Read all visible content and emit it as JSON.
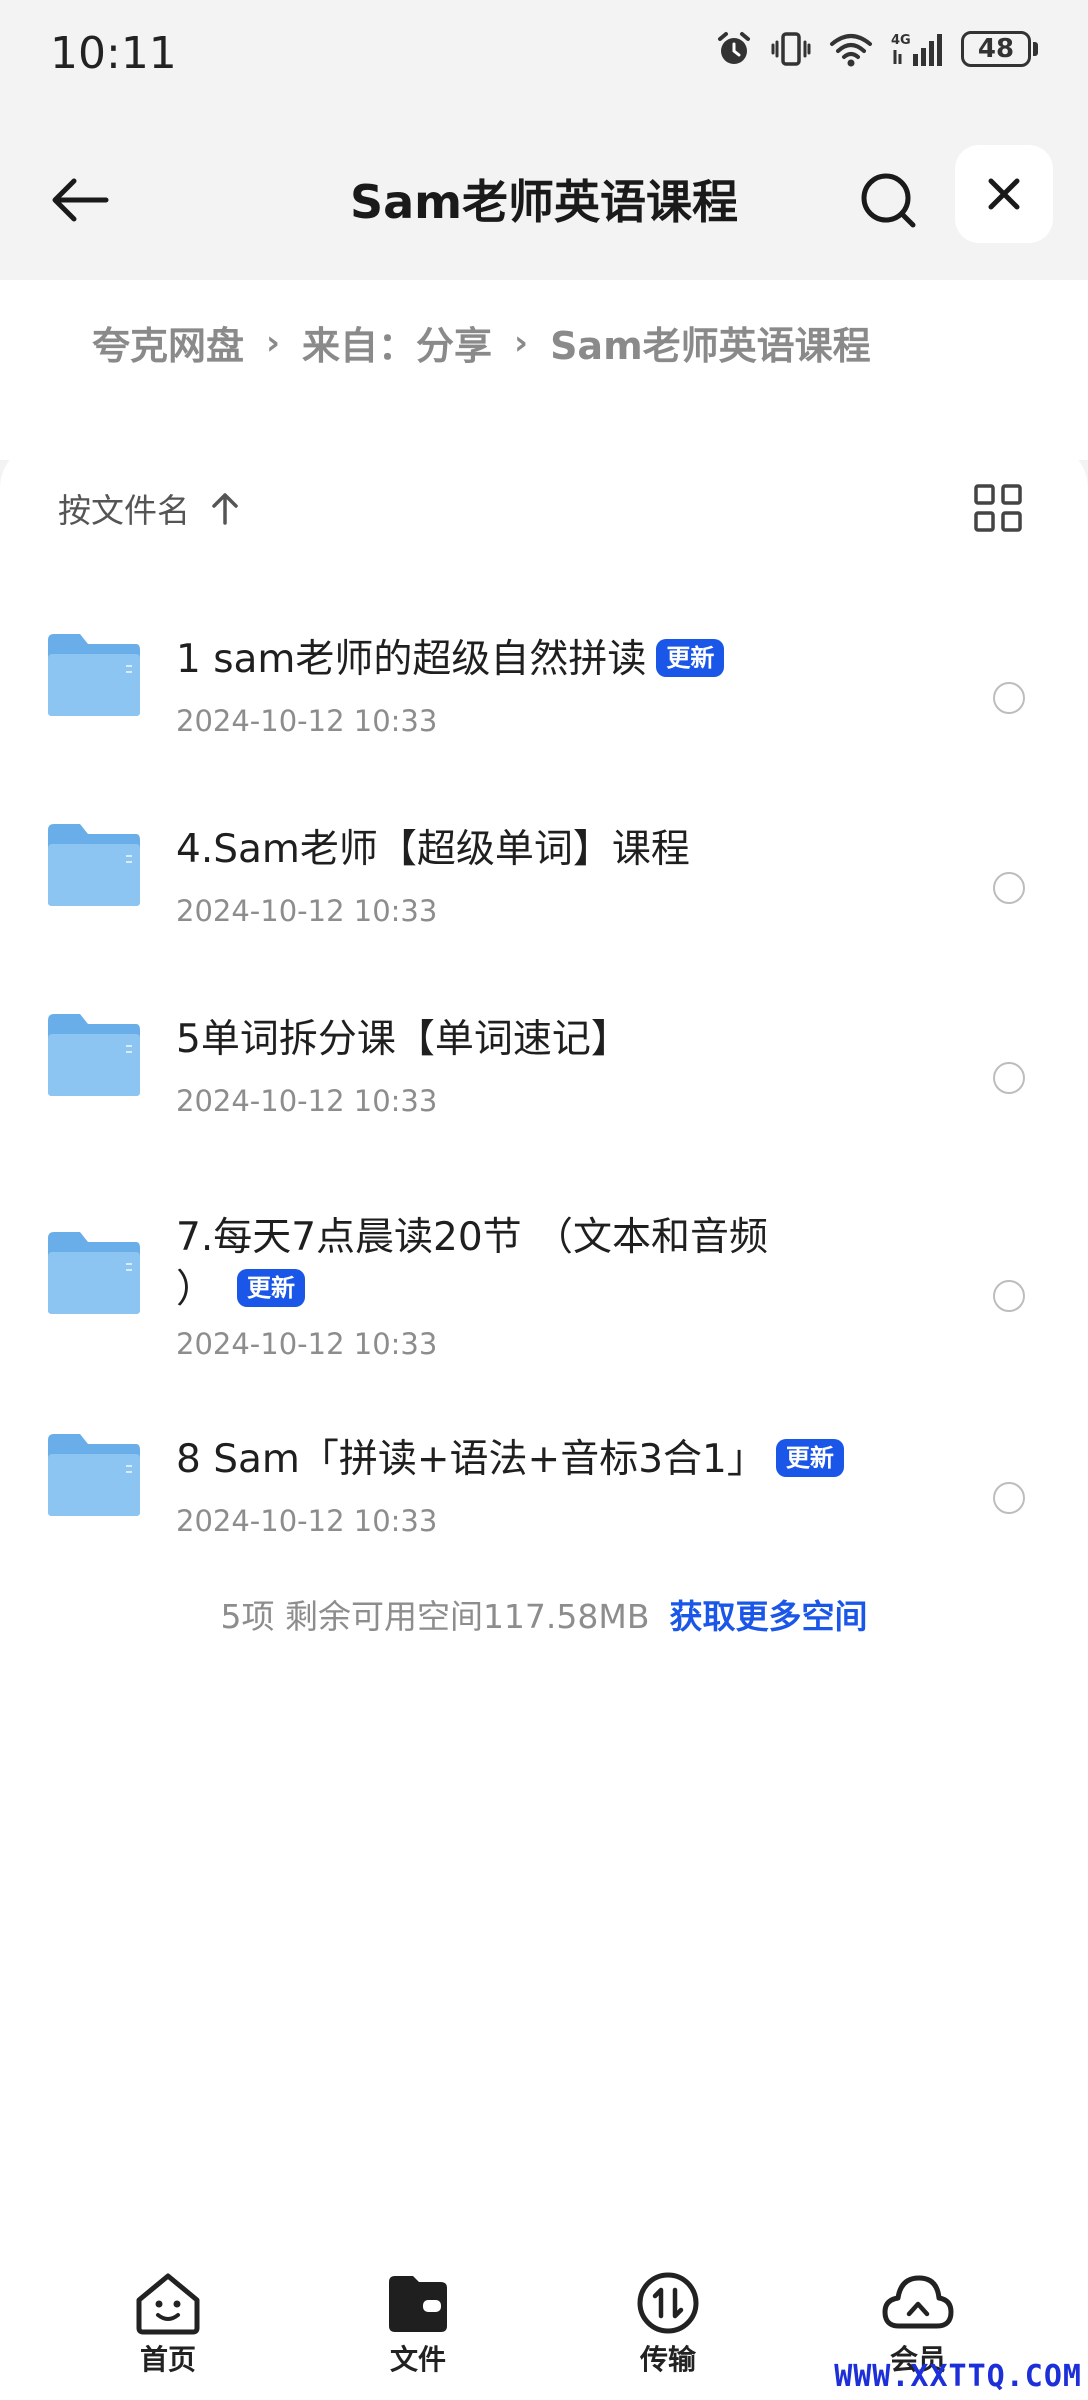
{
  "status_bar": {
    "time": "10:11",
    "battery": "48"
  },
  "header": {
    "title": "Sam老师英语课程"
  },
  "breadcrumb": [
    {
      "label": "夸克网盘"
    },
    {
      "label": "来自：分享"
    },
    {
      "label": "Sam老师英语课程"
    }
  ],
  "sort": {
    "label": "按文件名"
  },
  "files": [
    {
      "name": "1  sam老师的超级自然拼读",
      "badge": "更新",
      "date": "2024-10-12 10:33"
    },
    {
      "name": "4.Sam老师【超级单词】课程",
      "badge": "",
      "date": "2024-10-12 10:33"
    },
    {
      "name": "5单词拆分课【单词速记】",
      "badge": "",
      "date": "2024-10-12 10:33"
    },
    {
      "name_line1": "7.每天7点晨读20节 （文本和音频",
      "name_line2": "）",
      "badge": "更新",
      "date": "2024-10-12 10:33"
    },
    {
      "name": "8 Sam「拼读+语法+音标3合1」",
      "badge": "更新",
      "date": "2024-10-12 10:33"
    }
  ],
  "footer": {
    "summary": "5项 剩余可用空间117.58MB",
    "more_space": "获取更多空间"
  },
  "tabs": [
    {
      "label": "首页",
      "icon": "home-face-icon"
    },
    {
      "label": "文件",
      "icon": "folder-wallet-icon"
    },
    {
      "label": "传输",
      "icon": "transfer-icon"
    },
    {
      "label": "会员",
      "icon": "cloud-icon"
    }
  ],
  "watermark": "WWW.XXTTQ.COM",
  "colors": {
    "accent": "#1a56e8",
    "folder": "#7ab8ef",
    "background": "#f3f3f3"
  }
}
